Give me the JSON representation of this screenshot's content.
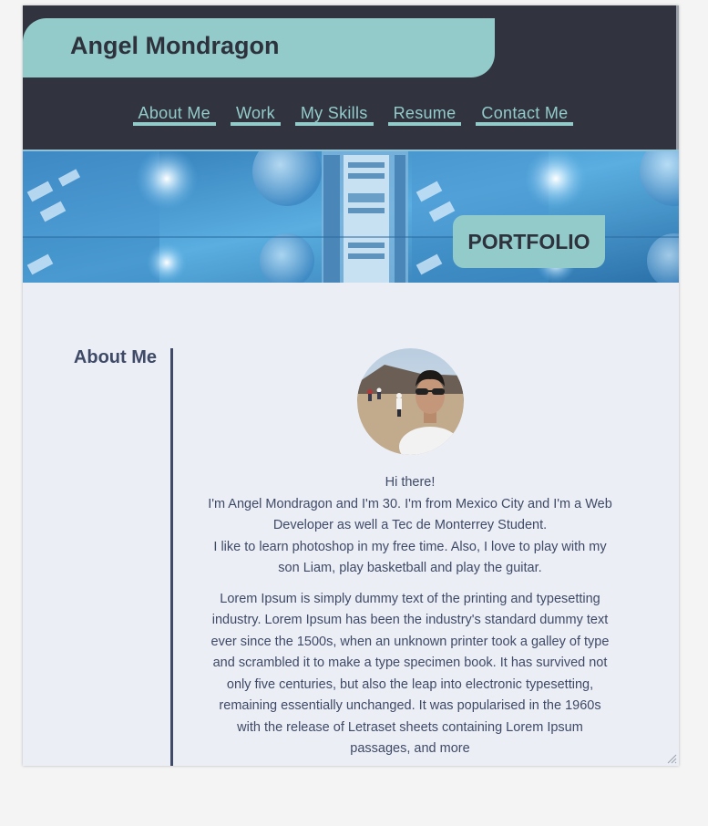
{
  "header": {
    "site_title": "Angel Mondragon",
    "nav": [
      {
        "label": "About Me"
      },
      {
        "label": "Work"
      },
      {
        "label": "My Skills"
      },
      {
        "label": "Resume"
      },
      {
        "label": "Contact Me"
      }
    ]
  },
  "banner": {
    "badge": "PORTFOLIO"
  },
  "main": {
    "side_heading": "About Me",
    "greeting": "Hi there!",
    "intro": "I'm Angel Mondragon and I'm 30. I'm from Mexico City and I'm a Web Developer as well a Tec de Monterrey Student.",
    "hobbies": "I like to learn photoshop in my free time. Also, I love to play with my son Liam, play basketball and play the guitar.",
    "lorem": "Lorem Ipsum is simply dummy text of the printing and typesetting industry. Lorem Ipsum has been the industry's standard dummy text ever since the 1500s, when an unknown printer took a galley of type and scrambled it to make a type specimen book. It has survived not only five centuries, but also the leap into electronic typesetting, remaining essentially unchanged. It was popularised in the 1960s with the release of Letraset sheets containing Lorem Ipsum passages, and more"
  },
  "colors": {
    "header_bg": "#31343f",
    "accent_teal": "#93cbcb",
    "content_bg": "#eceef6",
    "text_navy": "#3e4a66"
  }
}
